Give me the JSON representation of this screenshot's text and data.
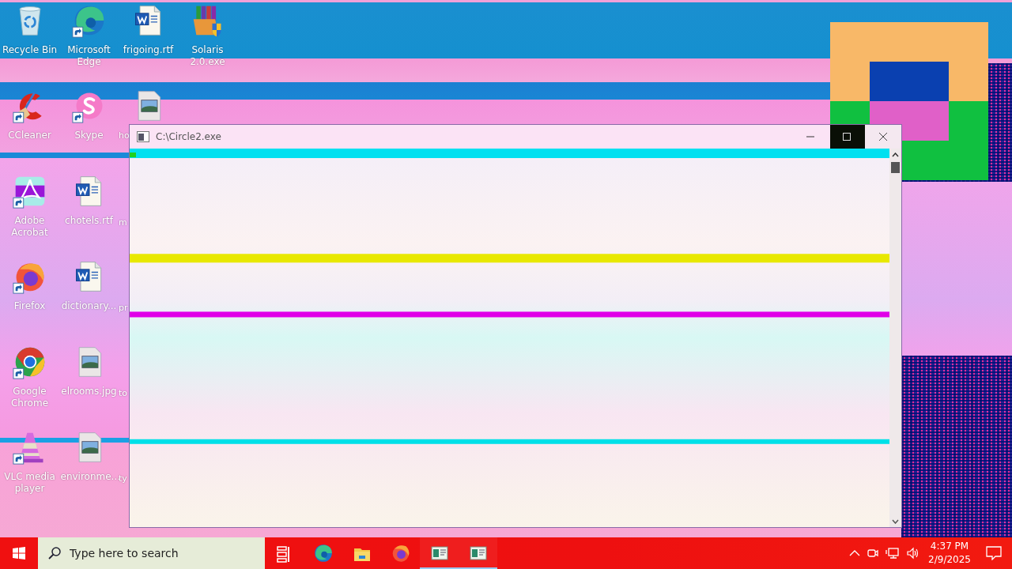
{
  "desktop": {
    "icon_rows": [
      [
        {
          "label": "Recycle Bin",
          "kind": "recycle-bin",
          "shortcut": false
        },
        {
          "label": "Microsoft Edge",
          "kind": "edge",
          "shortcut": true
        },
        {
          "label": "frigoing.rtf",
          "kind": "word-doc",
          "shortcut": false
        },
        {
          "label": "Solaris 2.0.exe",
          "kind": "archive",
          "shortcut": false
        }
      ],
      [
        {
          "label": "CCleaner",
          "kind": "ccleaner",
          "shortcut": true
        },
        {
          "label": "Skype",
          "kind": "skype",
          "shortcut": true
        },
        {
          "label": "ho",
          "kind": "image-file",
          "shortcut": false
        }
      ],
      [
        {
          "label": "Adobe Acrobat",
          "kind": "acrobat",
          "shortcut": true
        },
        {
          "label": "chotels.rtf",
          "kind": "word-doc",
          "shortcut": false
        },
        {
          "label": "m"
        }
      ],
      [
        {
          "label": "Firefox",
          "kind": "firefox",
          "shortcut": true
        },
        {
          "label": "dictionary...",
          "kind": "word-doc",
          "shortcut": false
        },
        {
          "label": "pr"
        }
      ],
      [
        {
          "label": "Google Chrome",
          "kind": "chrome",
          "shortcut": true
        },
        {
          "label": "elrooms.jpg",
          "kind": "image-file",
          "shortcut": false
        },
        {
          "label": "to"
        }
      ],
      [
        {
          "label": "VLC media player",
          "kind": "vlc",
          "shortcut": true
        },
        {
          "label": "environme...",
          "kind": "image-file",
          "shortcut": false
        },
        {
          "label": "ty"
        }
      ]
    ]
  },
  "window": {
    "title": "C:\\Circle2.exe"
  },
  "taskbar": {
    "search": {
      "placeholder": "Type here to search"
    },
    "apps": [
      {
        "kind": "task-view",
        "running": false
      },
      {
        "kind": "edge",
        "running": false
      },
      {
        "kind": "folder",
        "running": false
      },
      {
        "kind": "firefox",
        "running": false
      },
      {
        "kind": "app-window",
        "running": true
      },
      {
        "kind": "app-window",
        "running": true
      }
    ],
    "clock": {
      "time": "4:37 PM",
      "date": "2/9/2025"
    }
  }
}
